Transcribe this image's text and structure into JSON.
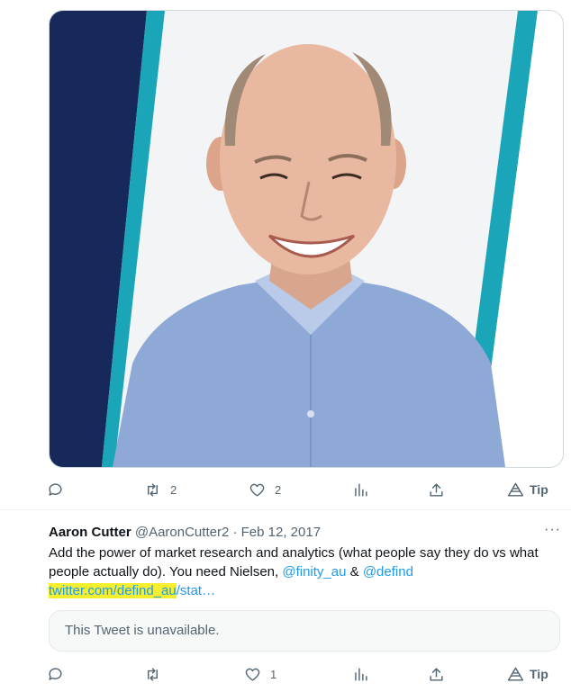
{
  "media": {
    "alt": "Headshot of a smiling man in a light blue collared shirt"
  },
  "first_actions": {
    "reply_count": "",
    "retweet_count": "2",
    "like_count": "2",
    "tip_label": "Tip"
  },
  "tweet": {
    "author_name": "Aaron Cutter",
    "handle": "@AaronCutter2",
    "separator": "·",
    "date": "Feb 12, 2017",
    "more_label": "···",
    "text_part1": "Add the power of market research and analytics (what people say they do vs what people actually do).  You need Nielsen, ",
    "mention1": "@finity_au",
    "amp": " & ",
    "mention2": "@defind",
    "url_highlighted": "twitter.com/defind_au",
    "url_rest": "/stat…",
    "quote_text": "This Tweet is unavailable."
  },
  "second_actions": {
    "reply_count": "",
    "retweet_count": "",
    "like_count": "1",
    "tip_label": "Tip"
  },
  "colors": {
    "link": "#1d9bf0",
    "highlight": "#f7ee2e",
    "muted": "#536471",
    "navy": "#1b2a5e",
    "teal": "#1aa5b8"
  }
}
